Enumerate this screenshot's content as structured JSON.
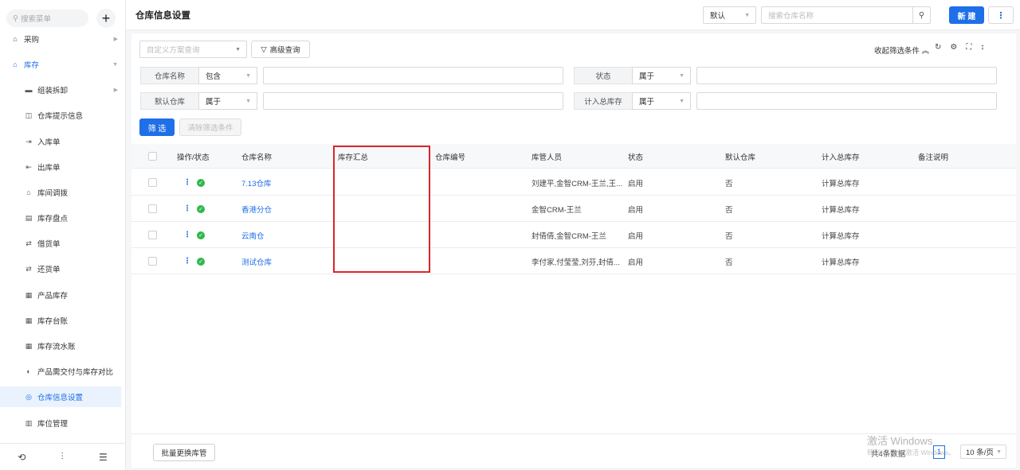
{
  "sidebar": {
    "search_placeholder": "搜索菜单",
    "items": [
      {
        "label": "采购",
        "icon": "⌂"
      },
      {
        "label": "库存",
        "icon": "⌂"
      },
      {
        "label": "组装拆卸",
        "icon": "▬"
      },
      {
        "label": "仓库提示信息",
        "icon": "◫"
      },
      {
        "label": "入库单",
        "icon": "⇥"
      },
      {
        "label": "出库单",
        "icon": "⇤"
      },
      {
        "label": "库间调拨",
        "icon": "⌂"
      },
      {
        "label": "库存盘点",
        "icon": "▤"
      },
      {
        "label": "借货单",
        "icon": "⇄"
      },
      {
        "label": "还货单",
        "icon": "⇄"
      },
      {
        "label": "产品库存",
        "icon": "▦"
      },
      {
        "label": "库存台账",
        "icon": "▦"
      },
      {
        "label": "库存流水账",
        "icon": "▦"
      },
      {
        "label": "产品需交付与库存对比",
        "icon": "◐"
      },
      {
        "label": "仓库信息设置",
        "icon": "◎"
      },
      {
        "label": "库位管理",
        "icon": "▥"
      }
    ]
  },
  "header": {
    "title": "仓库信息设置",
    "view_value": "默认",
    "search_placeholder": "搜索仓库名称",
    "new_label": "新 建",
    "more_label": "⋮"
  },
  "filters": {
    "scheme_placeholder": "自定义方案查询",
    "advanced_label": "高级查询",
    "collapse_label": "收起筛选条件 ︽",
    "rows": [
      {
        "label": "仓库名称",
        "op": "包含"
      },
      {
        "label": "状态",
        "op": "属于"
      },
      {
        "label": "默认仓库",
        "op": "属于"
      },
      {
        "label": "计入总库存",
        "op": "属于"
      }
    ],
    "filter_button": "筛 选",
    "clear_button": "清除筛选条件"
  },
  "table": {
    "headers": [
      "操作/状态",
      "仓库名称",
      "库存汇总",
      "仓库编号",
      "库管人员",
      "状态",
      "默认仓库",
      "计入总库存",
      "备注说明"
    ],
    "rows": [
      {
        "name": "7.13仓库",
        "summary": "",
        "code": "",
        "keepers": "刘建平,金智CRM-王兰,王...",
        "status": "启用",
        "default": "否",
        "count_total": "计算总库存",
        "note": ""
      },
      {
        "name": "香港分仓",
        "summary": "",
        "code": "",
        "keepers": "金智CRM-王兰",
        "status": "启用",
        "default": "否",
        "count_total": "计算总库存",
        "note": ""
      },
      {
        "name": "云南仓",
        "summary": "",
        "code": "",
        "keepers": "封倩倩,金智CRM-王兰",
        "status": "启用",
        "default": "否",
        "count_total": "计算总库存",
        "note": ""
      },
      {
        "name": "测试仓库",
        "summary": "",
        "code": "",
        "keepers": "李付家,付莹莹,刘芬,封倩...",
        "status": "启用",
        "default": "否",
        "count_total": "计算总库存",
        "note": ""
      }
    ]
  },
  "footer": {
    "batch_label": "批量更换库管",
    "total_text": "共4条数据",
    "page": "1",
    "page_size": "10 条/页"
  },
  "watermark": {
    "line1": "激活 Windows",
    "line2": "转到“设置”以激活 Windows。"
  }
}
